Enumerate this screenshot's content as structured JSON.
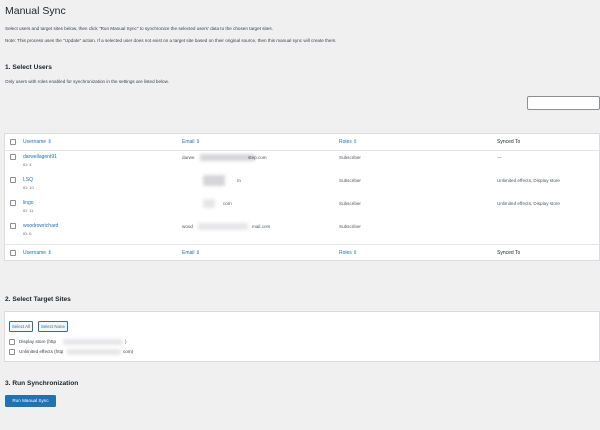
{
  "page": {
    "title": "Manual Sync",
    "description_1": "Select users and target sites below, then click \"Run Manual Sync\" to synchronize the selected users' data to the chosen target sites.",
    "description_2": "Note: This process uses the \"Update\" action. If a selected user does not exist on a target site based on their original source, then this manual sync will create them."
  },
  "select_users": {
    "heading": "1. Select Users",
    "help": "Only users with roles enabled for synchronization in the settings are listed below.",
    "search_value": "",
    "columns": [
      "Username ⇕",
      "Email ⇕",
      "Roles ⇕",
      "Synced To"
    ],
    "rows": [
      {
        "username": "darwellagent91",
        "id": "ID: 4",
        "email_start": "darwe",
        "email_end": "step.com",
        "role": "Subscriber",
        "synced_to": "—"
      },
      {
        "username": "LSQ",
        "id": "ID: 10",
        "email_start": "",
        "email_end": "m",
        "role": "Subscriber",
        "synced_to": "Unlimited effects, Display store"
      },
      {
        "username": "lingo",
        "id": "ID: 11",
        "email_start": "",
        "email_end": "com",
        "role": "Subscriber",
        "synced_to": "Unlimited effects, Display store"
      },
      {
        "username": "woodrowrichard",
        "id": "ID: 6",
        "email_start": "wood",
        "email_end": "mail.com",
        "role": "Subscriber",
        "synced_to": ""
      }
    ]
  },
  "select_sites": {
    "heading": "2. Select Target Sites",
    "select_all": "Select All",
    "select_none": "Select None",
    "sites": [
      {
        "label_start": "Display store (http",
        "label_end": ")"
      },
      {
        "label_start": "Unlimited effects (http",
        "label_end": "com)"
      }
    ]
  },
  "run": {
    "heading": "3. Run Synchronization",
    "button": "Run Manual Sync"
  },
  "colors": {
    "accent": "#2271b1",
    "background": "#f0f0f1",
    "panel": "#ffffff"
  }
}
